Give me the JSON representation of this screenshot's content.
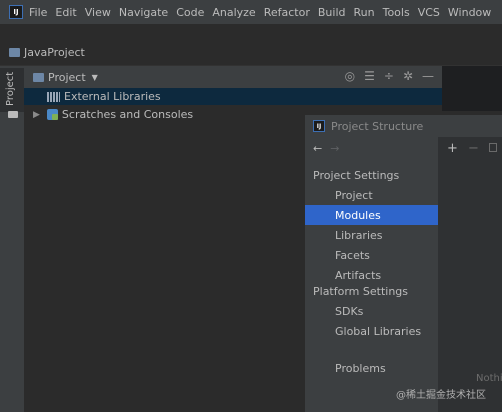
{
  "menubar": {
    "items": [
      "File",
      "Edit",
      "View",
      "Navigate",
      "Code",
      "Analyze",
      "Refactor",
      "Build",
      "Run",
      "Tools",
      "VCS",
      "Window"
    ]
  },
  "breadcrumb": {
    "project_name": "JavaProject"
  },
  "side_strip": {
    "tab_label": "Project"
  },
  "project_panel": {
    "title": "Project",
    "tree": [
      {
        "label": "External Libraries",
        "selected": true
      },
      {
        "label": "Scratches and Consoles",
        "selected": false
      }
    ]
  },
  "dialog": {
    "title": "Project Structure",
    "nav": {
      "back": "←",
      "forward": "→"
    },
    "toolbar": {
      "add": "+",
      "remove": "−"
    },
    "sections": [
      {
        "header": "Project Settings",
        "items": [
          "Project",
          "Modules",
          "Libraries",
          "Facets",
          "Artifacts"
        ]
      },
      {
        "header": "Platform Settings",
        "items": [
          "SDKs",
          "Global Libraries"
        ]
      }
    ],
    "bottom_items": [
      "Problems"
    ],
    "selected_item": "Modules",
    "empty_text": "Nothin"
  },
  "watermark": "@稀土掘金技术社区",
  "colors": {
    "background": "#2b2b2b",
    "panel": "#3c3f41",
    "selection": "#2f65ca",
    "tree_selection": "#0d293e"
  }
}
